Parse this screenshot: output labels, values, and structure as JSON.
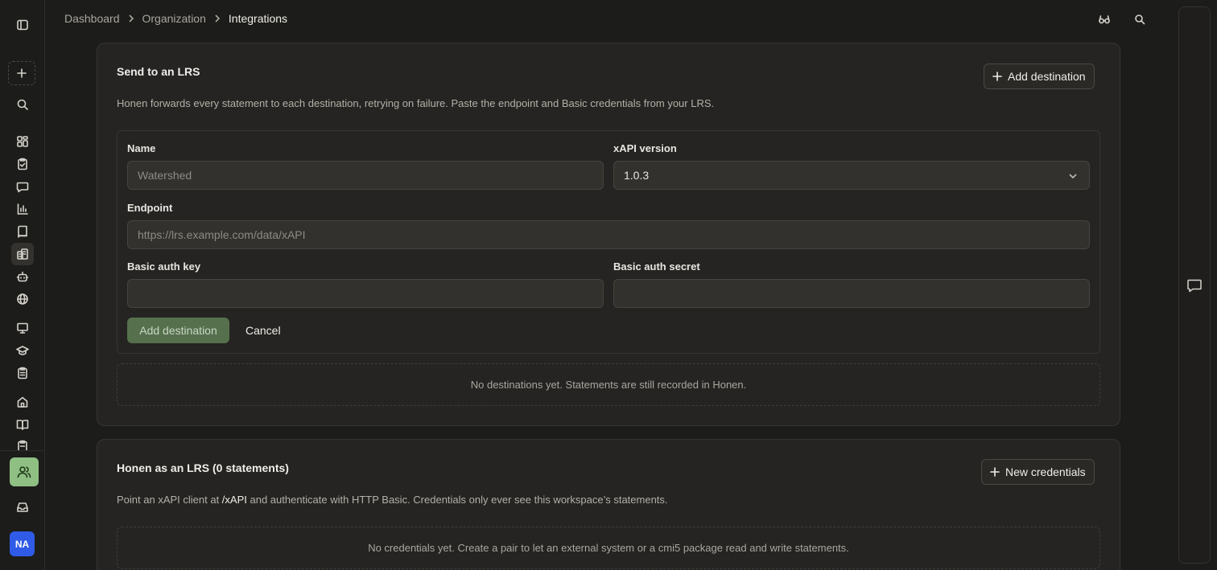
{
  "breadcrumb": {
    "items": [
      "Dashboard",
      "Organization"
    ],
    "current": "Integrations"
  },
  "sidebar": {
    "icons": [
      "panel-toggle-icon",
      "search-icon",
      "dashboard-icon",
      "clipboard-check-icon",
      "message-icon",
      "bar-chart-icon",
      "book-icon",
      "building-icon",
      "bot-icon",
      "globe-icon",
      "presentation-icon",
      "graduation-cap-icon",
      "clipboard-list-icon",
      "home-icon",
      "book-open-icon",
      "clipboard-icon",
      "users-icon",
      "inbox-icon"
    ],
    "avatar_initials": "NA",
    "active_color": "#8fbf83",
    "avatar_color": "#2f5be6"
  },
  "send_card": {
    "title": "Send to an LRS",
    "description": "Honen forwards every statement to each destination, retrying on failure. Paste the endpoint and Basic credentials from your LRS.",
    "add_button": "Add destination",
    "form": {
      "name_label": "Name",
      "name_placeholder": "Watershed",
      "version_label": "xAPI version",
      "version_value": "1.0.3",
      "endpoint_label": "Endpoint",
      "endpoint_placeholder": "https://lrs.example.com/data/xAPI",
      "key_label": "Basic auth key",
      "secret_label": "Basic auth secret",
      "submit_label": "Add destination",
      "cancel_label": "Cancel"
    },
    "empty_text": "No destinations yet. Statements are still recorded in Honen."
  },
  "lrs_card": {
    "title": "Honen as an LRS (0 statements)",
    "description_pre": "Point an xAPI client at ",
    "description_code": "/xAPI",
    "description_post": " and authenticate with HTTP Basic. Credentials only ever see this workspace’s statements.",
    "new_button": "New credentials",
    "empty_text": "No credentials yet. Create a pair to let an external system or a cmi5 package read and write statements."
  },
  "accent_color": "#56704d"
}
